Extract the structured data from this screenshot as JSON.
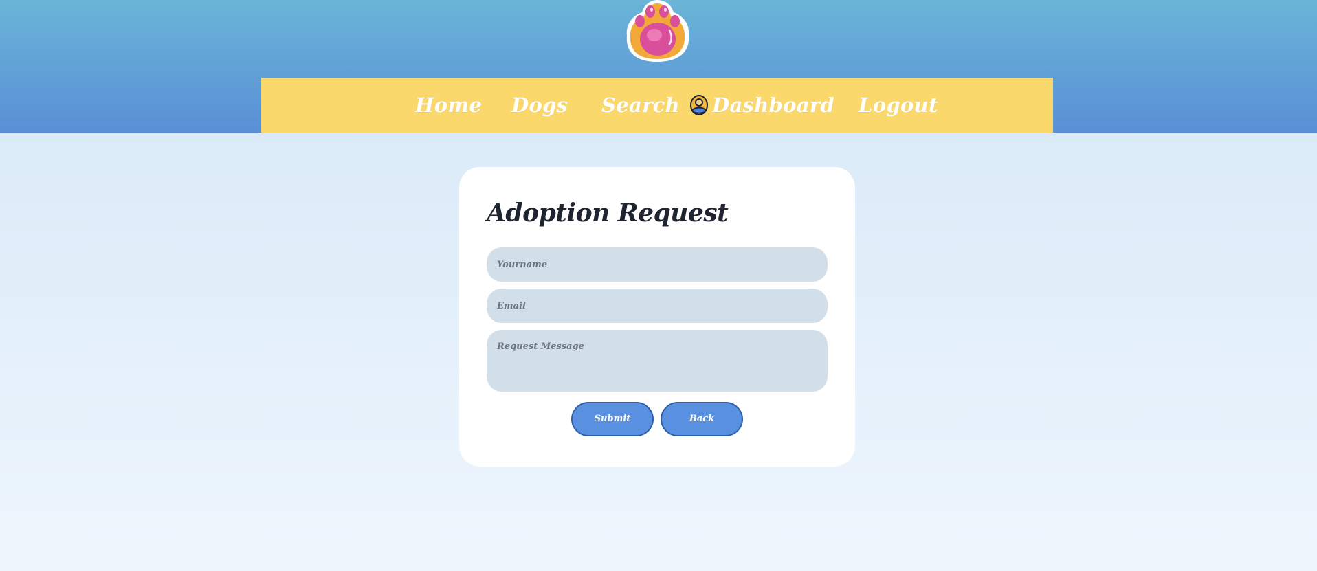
{
  "brand": {
    "logo_icon": "paw-icon",
    "accent": "#fad86c",
    "primary": "#5a90e0"
  },
  "nav": {
    "home": "Home",
    "dogs": "Dogs",
    "search": "Search",
    "dashboard": "Dashboard",
    "dashboard_icon": "user-avatar-icon",
    "logout": "Logout"
  },
  "form": {
    "title": "Adoption Request",
    "name_placeholder": "Yourname",
    "email_placeholder": "Email",
    "message_placeholder": "Request Message",
    "name_value": "",
    "email_value": "",
    "message_value": "",
    "submit_label": "Submit",
    "back_label": "Back"
  }
}
